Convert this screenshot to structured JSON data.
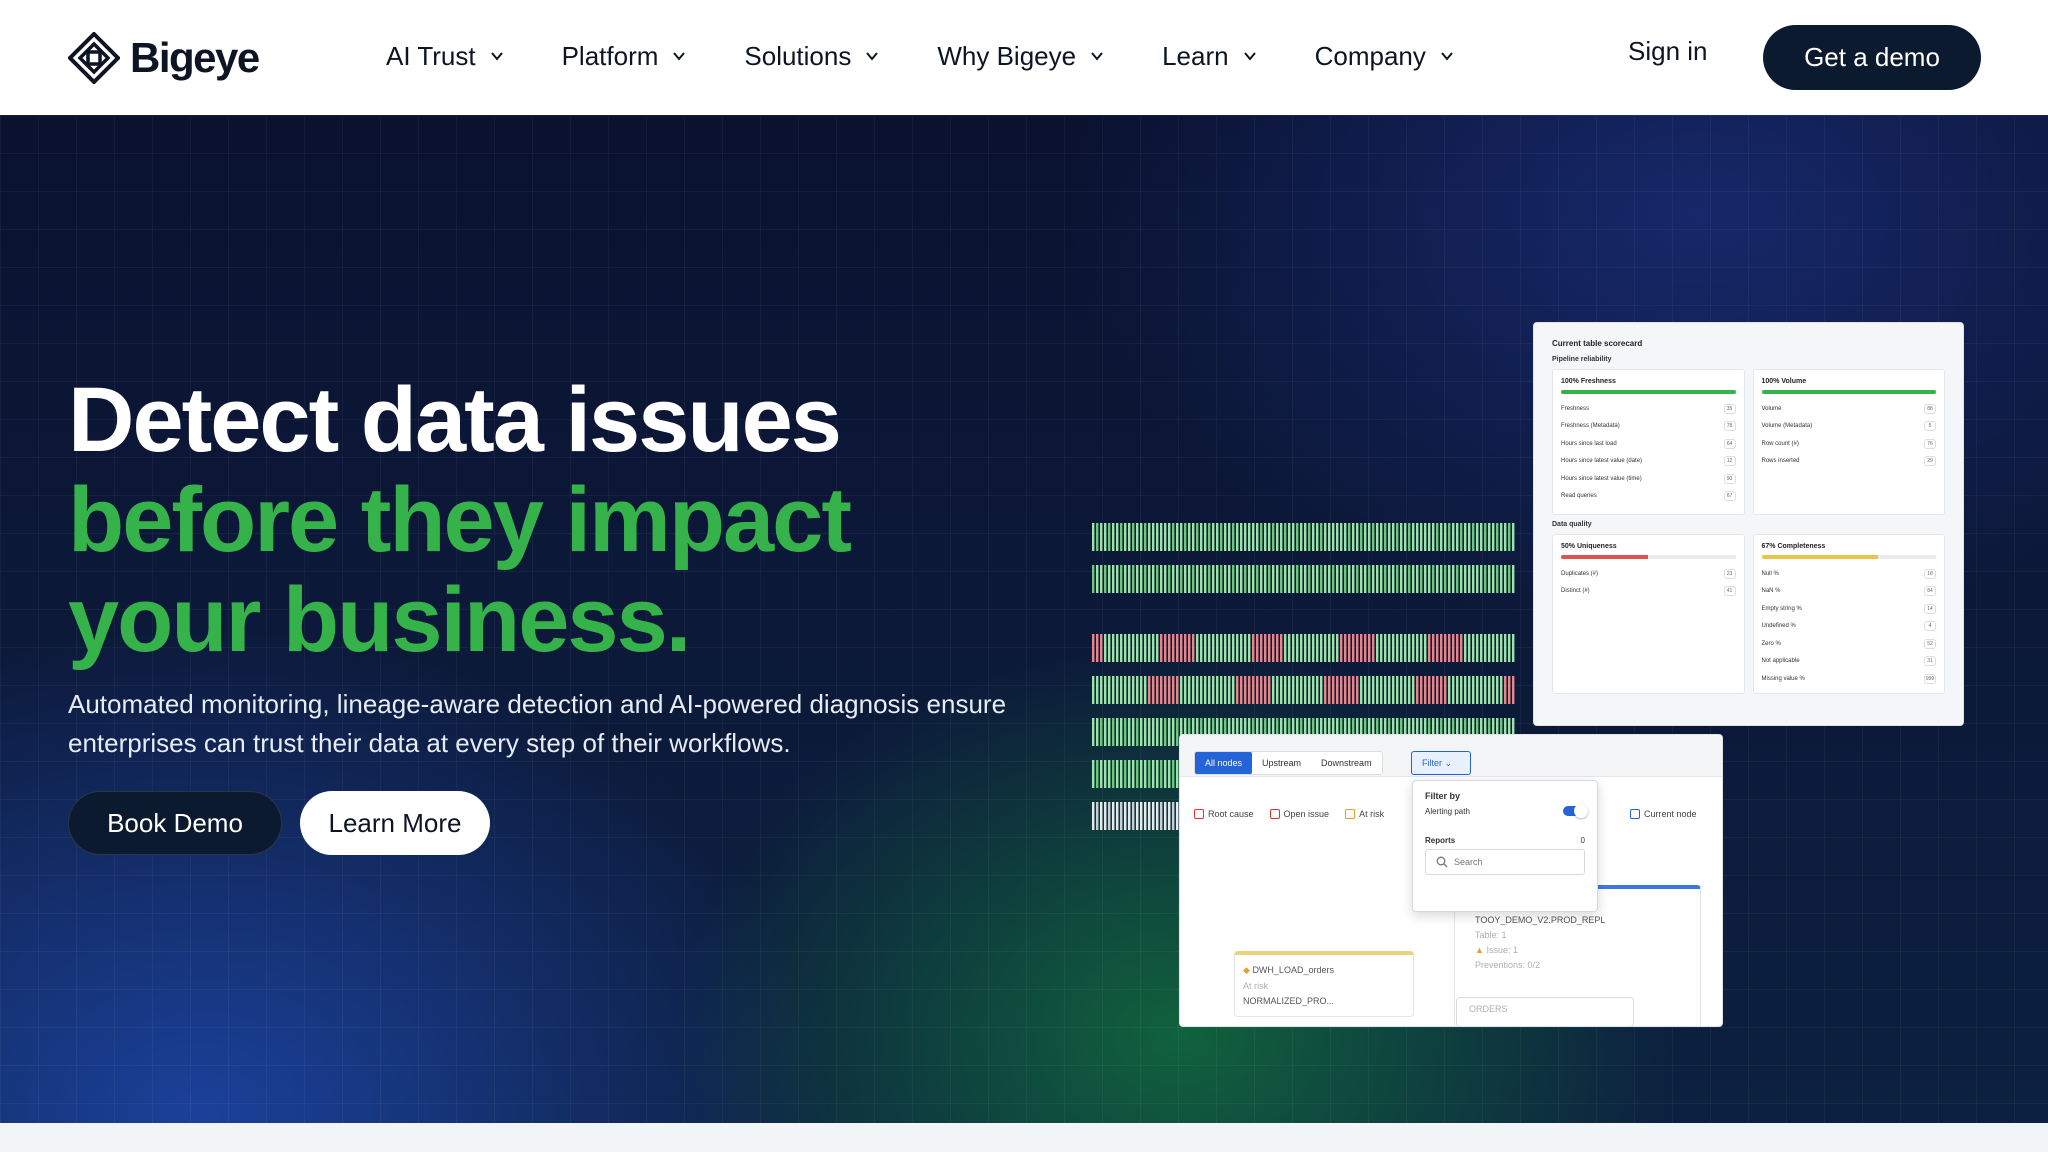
{
  "brand": {
    "name": "Bigeye"
  },
  "nav": {
    "items": [
      {
        "label": "AI Trust"
      },
      {
        "label": "Platform"
      },
      {
        "label": "Solutions"
      },
      {
        "label": "Why Bigeye"
      },
      {
        "label": "Learn"
      },
      {
        "label": "Company"
      }
    ],
    "sign_in": "Sign in",
    "cta": "Get a demo"
  },
  "hero": {
    "line1": "Detect data issues",
    "line2": "before they impact",
    "line3": "your business.",
    "subtext": "Automated monitoring, lineage-aware detection and AI-powered diagnosis ensure enterprises can trust their data at every step of their workflows.",
    "primary_button": "Book Demo",
    "secondary_button": "Learn More"
  },
  "colors": {
    "accent_green": "#36b24a",
    "dark_button": "#0b1a2e",
    "hero_bg": "#0c1838"
  },
  "scorecard": {
    "title": "Current table scorecard",
    "section1": "Pipeline reliability",
    "freshness": {
      "head": "100% Freshness",
      "score": 1.0,
      "rows": [
        {
          "label": "Freshness",
          "value": "35"
        },
        {
          "label": "Freshness (Metadata)",
          "value": "78"
        },
        {
          "label": "Hours since last load",
          "value": "64"
        },
        {
          "label": "Hours since latest value (date)",
          "value": "12"
        },
        {
          "label": "Hours since latest value (time)",
          "value": "90"
        },
        {
          "label": "Read queries",
          "value": "67"
        }
      ]
    },
    "volume": {
      "head": "100% Volume",
      "score": 1.0,
      "rows": [
        {
          "label": "Volume",
          "value": "88"
        },
        {
          "label": "Volume (Metadata)",
          "value": "5"
        },
        {
          "label": "Row count (#)",
          "value": "76"
        },
        {
          "label": "Rows inserted",
          "value": "29"
        }
      ]
    },
    "section2": "Data quality",
    "uniqueness": {
      "head": "50% Uniqueness",
      "score": 0.5,
      "rows": [
        {
          "label": "Duplicates (#)",
          "value": "23"
        },
        {
          "label": "Distinct (#)",
          "value": "41"
        }
      ]
    },
    "completeness": {
      "head": "67% Completeness",
      "score": 0.67,
      "rows": [
        {
          "label": "Null %",
          "value": "18"
        },
        {
          "label": "NaN %",
          "value": "84"
        },
        {
          "label": "Empty string %",
          "value": "14"
        },
        {
          "label": "Undefined %",
          "value": "4"
        },
        {
          "label": "Zero %",
          "value": "52"
        },
        {
          "label": "Not applicable",
          "value": "31"
        },
        {
          "label": "Missing value %",
          "value": "999"
        }
      ]
    }
  },
  "lineage": {
    "tabs": [
      {
        "label": "All nodes"
      },
      {
        "label": "Upstream"
      },
      {
        "label": "Downstream"
      }
    ],
    "filter_label": "Filter",
    "legend": [
      {
        "label": "Root cause"
      },
      {
        "label": "Open issue"
      },
      {
        "label": "At risk"
      }
    ],
    "current_node": "Current node",
    "filter_popup": {
      "title": "Filter by",
      "alerting_path": "Alerting path",
      "reports": "Reports",
      "reports_count": "0",
      "search_placeholder": "Search"
    },
    "node_a": {
      "name": "DWH_LOAD_orders",
      "status": "At risk",
      "child": "NORMALIZED_PRO..."
    },
    "node_b": {
      "name": "TOOY_DEMO_V2.PROD_REPL",
      "table": "Table: 1",
      "issue": "Issue: 1",
      "preventions": "Preventions: 0/2"
    },
    "node_c": {
      "name": "ORDERS"
    }
  }
}
